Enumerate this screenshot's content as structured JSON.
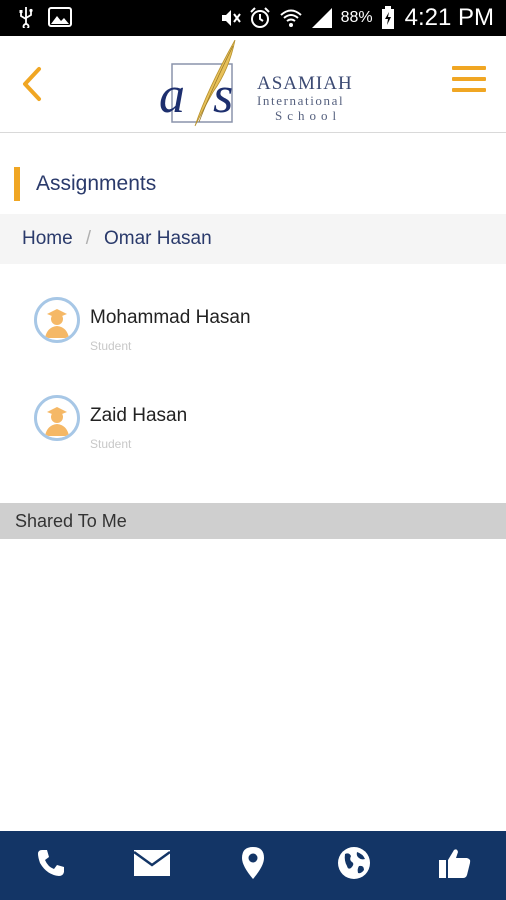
{
  "status_bar": {
    "battery_percent": "88%",
    "time": "4:21 PM",
    "icons": [
      "usb-icon",
      "image-icon",
      "mute-icon",
      "alarm-icon",
      "wifi-icon",
      "signal-icon",
      "battery-icon"
    ]
  },
  "header": {
    "logo_monogram": "a/s",
    "logo_name": "ASAMIAH",
    "logo_subtitle_1": "International",
    "logo_subtitle_2": "School",
    "back_icon": "chevron-left-icon",
    "menu_icon": "hamburger-menu-icon"
  },
  "page": {
    "title": "Assignments"
  },
  "breadcrumb": {
    "home": "Home",
    "separator": "/",
    "current": "Omar Hasan"
  },
  "students": [
    {
      "name": "Mohammad Hasan",
      "role": "Student"
    },
    {
      "name": "Zaid Hasan",
      "role": "Student"
    }
  ],
  "shared_section": {
    "label": "Shared To Me"
  },
  "bottom_nav": {
    "items": [
      "phone-icon",
      "mail-icon",
      "location-icon",
      "globe-icon",
      "thumbs-up-icon"
    ]
  },
  "colors": {
    "accent": "#f0a623",
    "brand_navy": "#133566",
    "text_navy": "#2a3a6b",
    "avatar_ring": "#a7c7e6"
  }
}
